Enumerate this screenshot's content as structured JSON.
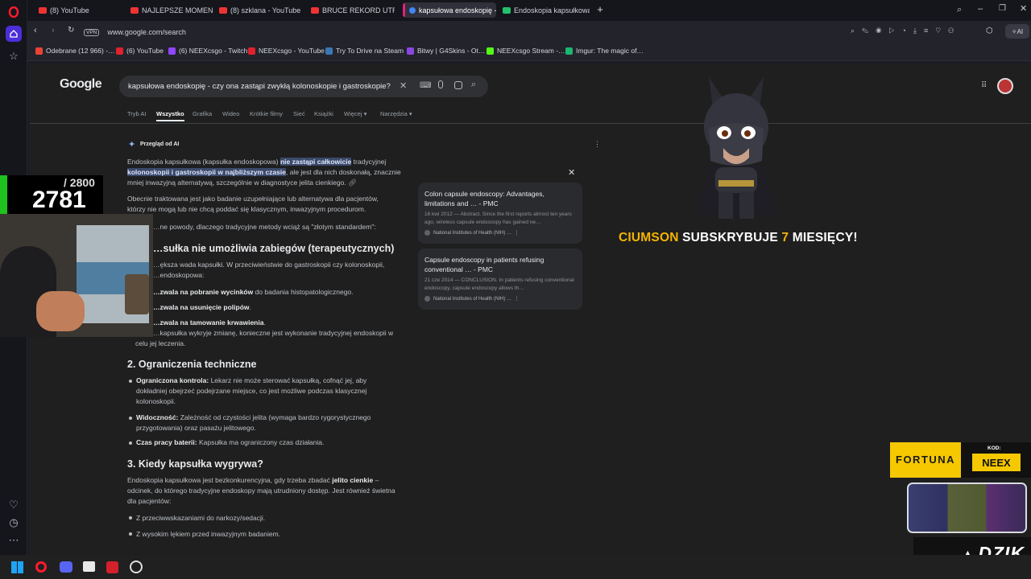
{
  "tabs": [
    {
      "label": "(8) YouTube",
      "color": "#e0212e"
    },
    {
      "label": "NAJLEPSZE MOMENTY P…",
      "color": "#e0212e"
    },
    {
      "label": "(8) szklana - YouTube",
      "color": "#e0212e"
    },
    {
      "label": "BRUCE REKORD UTRATY W…",
      "color": "#e0212e"
    },
    {
      "label": "kapsułowa endoskopię - …",
      "color": "#4285f4"
    },
    {
      "label": "Endoskopia kapsułkowa - …",
      "color": "#21c26b"
    }
  ],
  "address": {
    "vpn": "VPN",
    "url": "www.google.com/search",
    "ai_label": "AI"
  },
  "bookmarks": [
    {
      "label": "Odebrane (12 966) -…",
      "color": "#ea4335"
    },
    {
      "label": "(6) YouTube",
      "color": "#e0212e"
    },
    {
      "label": "(6) NEEXcsgo - Twitch",
      "color": "#9146ff"
    },
    {
      "label": "NEEXcsgo - YouTube",
      "color": "#e0212e"
    },
    {
      "label": "Try To Drive na Steam",
      "color": "#3a78b5"
    },
    {
      "label": "Bitwy | G4Skins - Ot…",
      "color": "#8a47e0"
    },
    {
      "label": "NEEXcsgo Stream -…",
      "color": "#53fc18"
    },
    {
      "label": "Imgur: The magic of…",
      "color": "#1bb76e"
    }
  ],
  "google": {
    "logo": "Google",
    "query": "kapsułowa endoskopię - czy ona zastąpi zwykłą kolonoskopie i gastroskopie?",
    "nav": [
      "Tryb AI",
      "Wszystko",
      "Grafika",
      "Wideo",
      "Krótkie filmy",
      "Sieć",
      "Książki",
      "Więcej ▾",
      "Narzędzia ▾"
    ],
    "ai_overview_label": "Przegląd od AI",
    "p1_a": "Endoskopia kapsułkowa (kapsułka endoskopowa) ",
    "p1_hl1": "nie zastąpi całkowicie",
    "p1_b": " tradycyjnej",
    "p1_hl2": "kolonoskopii i gastroskopii w najbliższym czasie",
    "p1_c": ", ale jest dla nich doskonałą, znacznie",
    "p1_d": "mniej inwazyjną alternatywą, szczególnie w diagnostyce jelita cienkiego.",
    "p2_l1": "Obecnie traktowana jest jako badanie uzupełniające lub alternatywa dla pacjentów,",
    "p2_l2": "którzy nie mogą lub nie chcą poddać się klasycznym, inwazyjnym procedurom.",
    "p3": "…ne powody, dlaczego tradycyjne metody wciąż są \"złotym standardem\":",
    "h1": "…sułka nie umożliwia zabiegów (terapeutycznych)",
    "s1_l1": "…ększa wada kapsułki. W przeciwieństwie do gastroskopii czy kolonoskopii,",
    "s1_l2": "…endoskopowa:",
    "b1": "…zwala na pobranie wycinków",
    "b1_rest": " do badania histopatologicznego.",
    "b2": "…zwala na usunięcie polipów",
    "b2_rest": ".",
    "b3": "…zwala na tamowanie krwawienia",
    "b3_rest": ".",
    "b3_l2": "…kapsułka wykryje zmianę, konieczne jest wykonanie tradycyjnej endoskopii w",
    "b3_l3": "celu jej leczenia.",
    "h2": "2. Ograniczenia techniczne",
    "t1_b": "Ograniczona kontrola:",
    "t1_r": " Lekarz nie może sterować kapsułką, cofnąć jej, aby",
    "t1_l2": "dokładniej obejrzeć podejrzane miejsce, co jest możliwe podczas klasycznej",
    "t1_l3": "kolonoskopii.",
    "t2_b": "Widoczność:",
    "t2_r": " Zależność od czystości jelita (wymaga bardzo rygorystycznego",
    "t2_l2": "przygotowania) oraz pasażu jelitowego.",
    "t3_b": "Czas pracy baterii:",
    "t3_r": " Kapsułka ma ograniczony czas działania.",
    "h3": "3. Kiedy kapsułka wygrywa?",
    "w1": "Endoskopia kapsułkowa jest bezkonkurencyjna, gdy trzeba zbadać ",
    "w1_b": "jelito cienkie",
    "w1_r": " –",
    "w2": "odcinek, do którego tradycyjne endoskopy mają utrudniony dostęp. Jest również świetna",
    "w3": "dla pacjentów:",
    "w_b1": "Z przeciwwskazaniami do narkozy/sedacji.",
    "w_b2": "Z wysokim lękiem przed inwazyjnym badaniem."
  },
  "sources": [
    {
      "title": "Colon capsule endoscopy: Advantages, limitations and … - PMC",
      "snippet": "16 kwi 2012 — Abstract. Since the first reports almost ten years ago, wireless capsule endoscopy has gained ne…",
      "source": "National Institutes of Health (NIH) …"
    },
    {
      "title": "Capsule endoscopy in patients refusing conventional … - PMC",
      "snippet": "21 cze 2014 — CONCLUSION. In patients refusing conventional endoscopy, capsule endoscopy allows th…",
      "source": "National Institutes of Health (NIH) …"
    }
  ],
  "stream": {
    "goal": "/ 2800",
    "count": "2781",
    "sub_name": "CIUMSON",
    "sub_mid": " SUBSKRYBUJE ",
    "sub_num": "7",
    "sub_end": " MIESIĘCY!",
    "sponsor": "FORTUNA",
    "code_label": "KOD:",
    "code": "NEEX",
    "brand": "DZIK"
  },
  "colors": {
    "accent_gold": "#f5b400",
    "green_bar": "#1ec31e"
  }
}
